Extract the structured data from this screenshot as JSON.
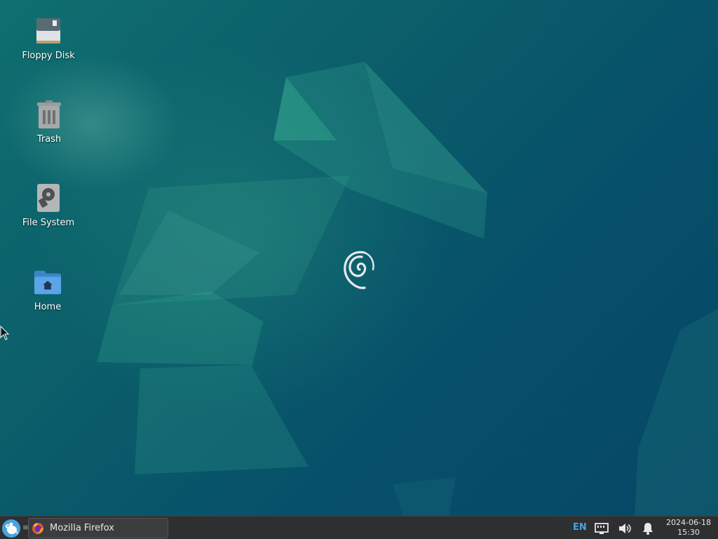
{
  "desktop": {
    "icons": [
      {
        "label": "Floppy Disk",
        "icon": "floppy-disk-icon"
      },
      {
        "label": "Trash",
        "icon": "trash-icon"
      },
      {
        "label": "File System",
        "icon": "hard-drive-icon"
      },
      {
        "label": "Home",
        "icon": "home-folder-icon"
      }
    ],
    "wallpaper": {
      "logo": "debian-swirl-icon",
      "colors": {
        "base": "#075a6a",
        "accent": "#2fa88a"
      }
    }
  },
  "taskbar": {
    "menu_icon": "xfce-mouse-icon",
    "separator": "≡",
    "tasks": [
      {
        "label": "Mozilla Firefox",
        "icon": "firefox-icon"
      }
    ],
    "tray": {
      "language": "EN",
      "network_icon": "network-wired-icon",
      "volume_icon": "speaker-volume-icon",
      "notification_icon": "bell-icon"
    },
    "clock": {
      "date": "2024-06-18",
      "time": "15:30"
    },
    "colors": {
      "panel": "#2d2f30",
      "accent": "#4aa3df"
    }
  }
}
